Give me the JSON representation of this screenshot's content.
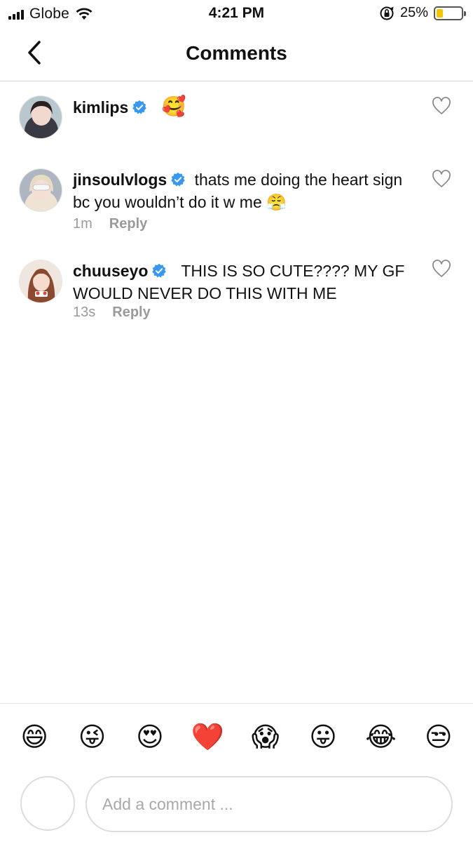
{
  "status_bar": {
    "carrier": "Globe",
    "time": "4:21 PM",
    "battery_percent": "25%",
    "battery_level": 0.25,
    "icons": [
      "signal-bars-icon",
      "wifi-icon",
      "orientation-lock-icon",
      "battery-icon"
    ]
  },
  "header": {
    "title": "Comments",
    "back_icon": "chevron-left-icon"
  },
  "comments": [
    {
      "username": "kimlips",
      "verified": true,
      "text": "🥰",
      "time": "",
      "reply_label": "",
      "avatar_color": "#d9c9c4"
    },
    {
      "username": "jinsoulvlogs",
      "verified": true,
      "text": "thats me doing the heart sign bc you wouldn’t do it w me 😤",
      "time": "1m",
      "reply_label": "Reply",
      "avatar_color": "#c9c0c6"
    },
    {
      "username": "chuuseyo",
      "verified": true,
      "text": "THIS IS SO CUTE???? MY GF WOULD NEVER DO THIS WITH ME",
      "time": "13s",
      "reply_label": "Reply",
      "avatar_color": "#c98a6e"
    }
  ],
  "emoji_bar": [
    "😄",
    "😜",
    "😍",
    "❤️",
    "😱",
    "😛",
    "😂",
    "😒"
  ],
  "composer": {
    "placeholder": "Add a comment ...",
    "value": ""
  },
  "colors": {
    "verified_blue": "#3897f0",
    "meta_gray": "#9a9a9a",
    "divider": "#d6d6d6",
    "battery_yellow": "#f5c400"
  }
}
